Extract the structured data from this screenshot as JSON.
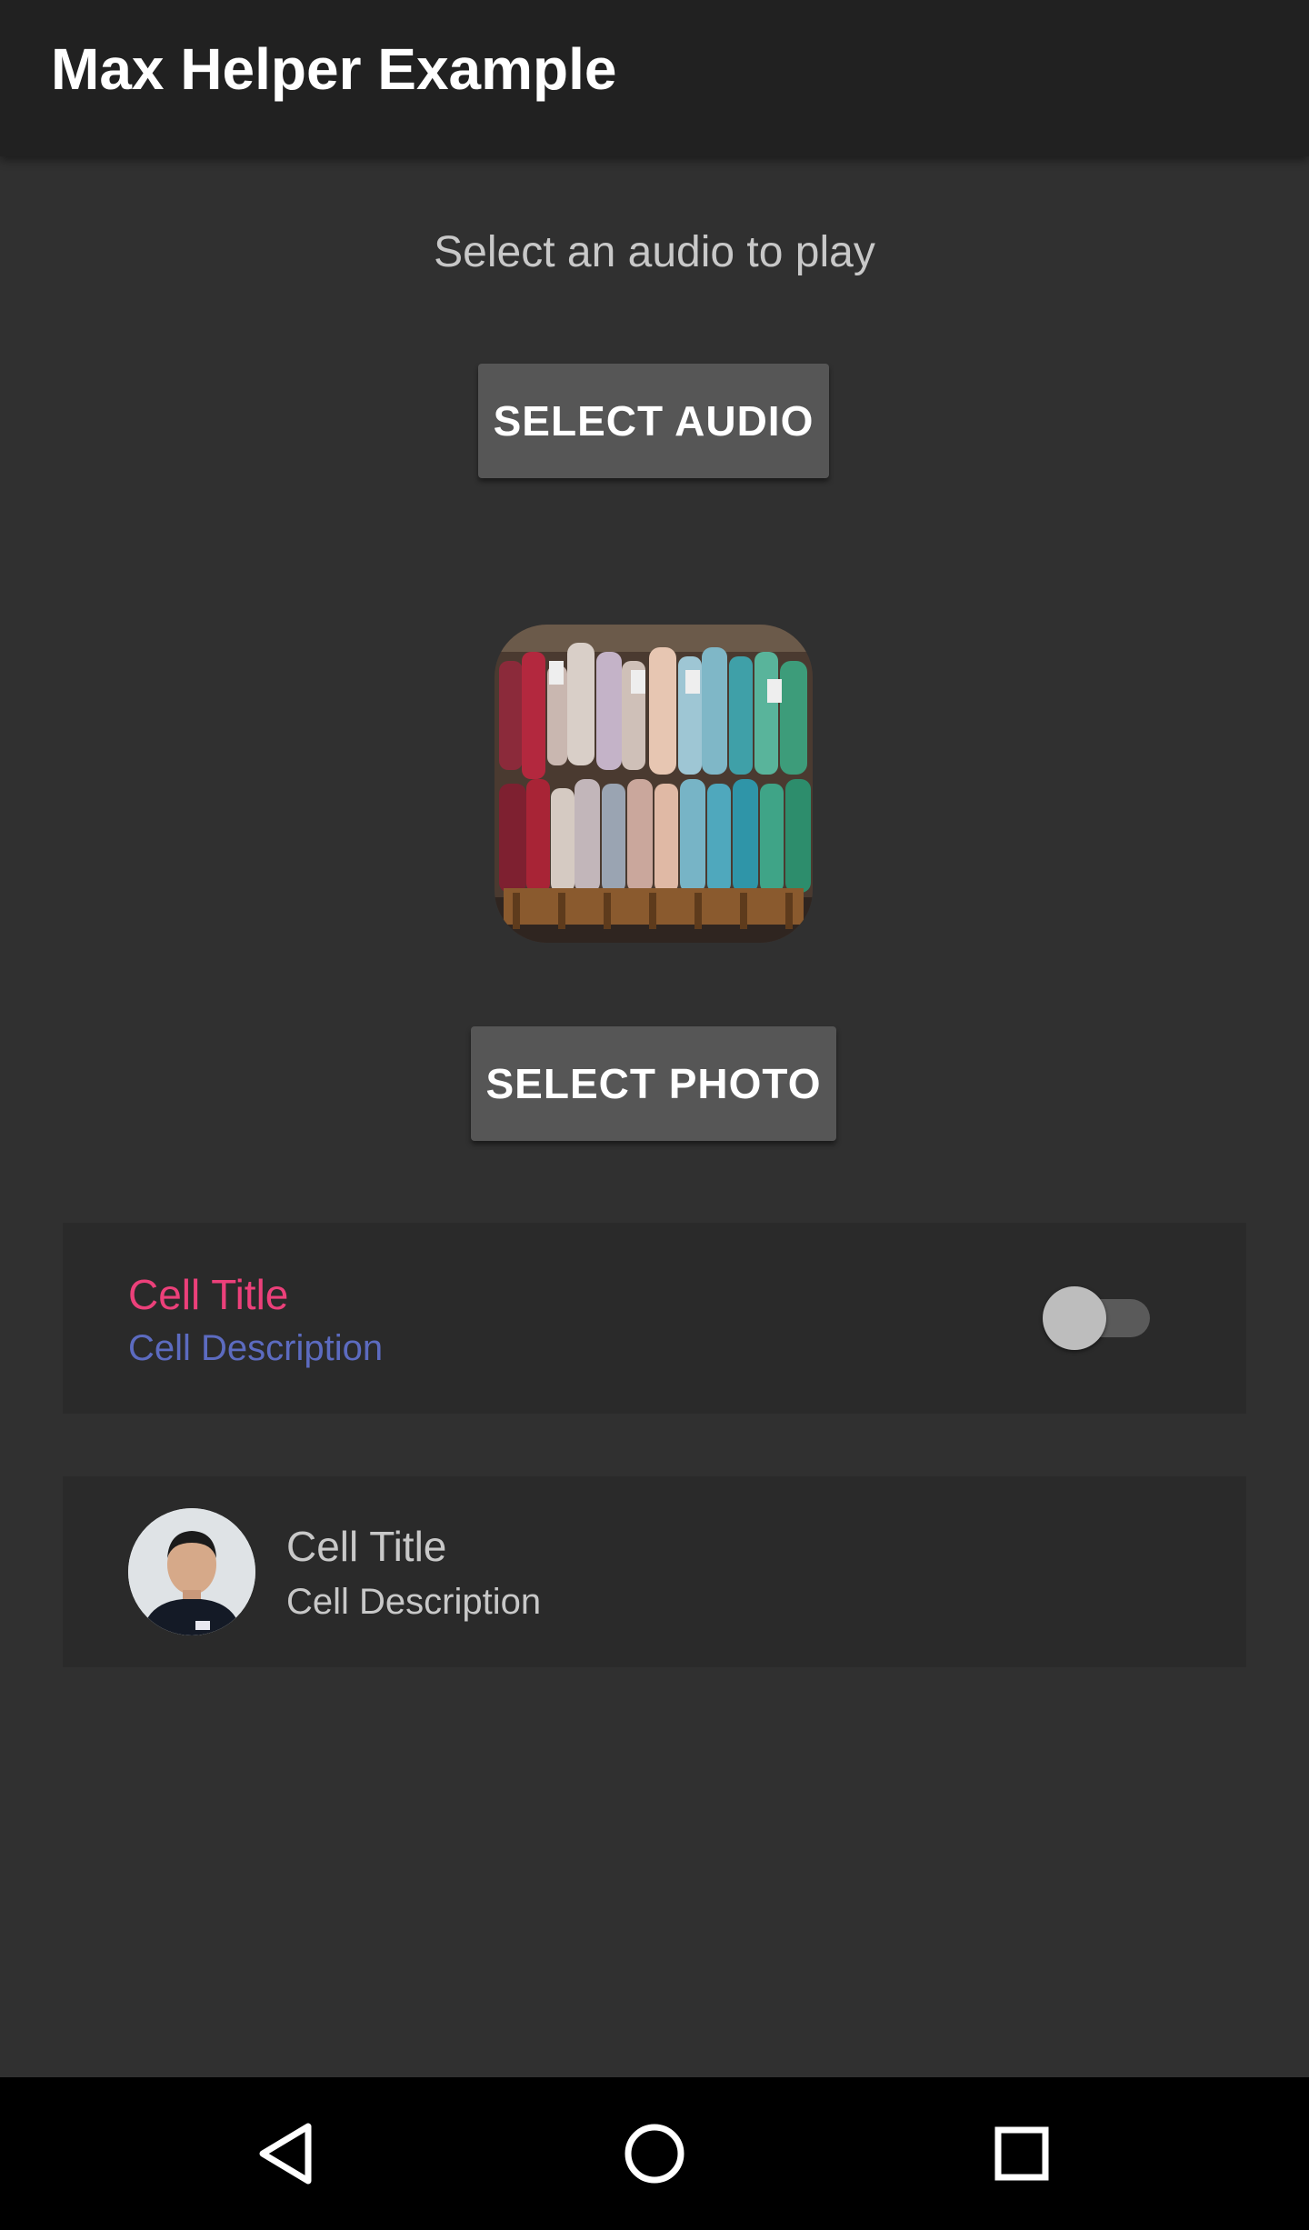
{
  "app_bar": {
    "title": "Max Helper Example"
  },
  "audio_section": {
    "prompt": "Select an audio to play",
    "button_label": "SELECT AUDIO"
  },
  "photo_section": {
    "button_label": "SELECT PHOTO"
  },
  "cells": [
    {
      "title": "Cell Title",
      "description": "Cell Description",
      "title_color": "#ec407a",
      "description_color": "#5c6bc0",
      "switch_on": false
    },
    {
      "title": "Cell Title",
      "description": "Cell Description",
      "has_avatar": true
    }
  ],
  "nav_bar": {
    "icons": [
      "back-icon",
      "home-icon",
      "recents-icon"
    ]
  },
  "colors": {
    "app_bar": "#212121",
    "background": "#303030",
    "cell_background": "#2a2a2a",
    "button": "#565656",
    "nav_bar": "#000000"
  }
}
